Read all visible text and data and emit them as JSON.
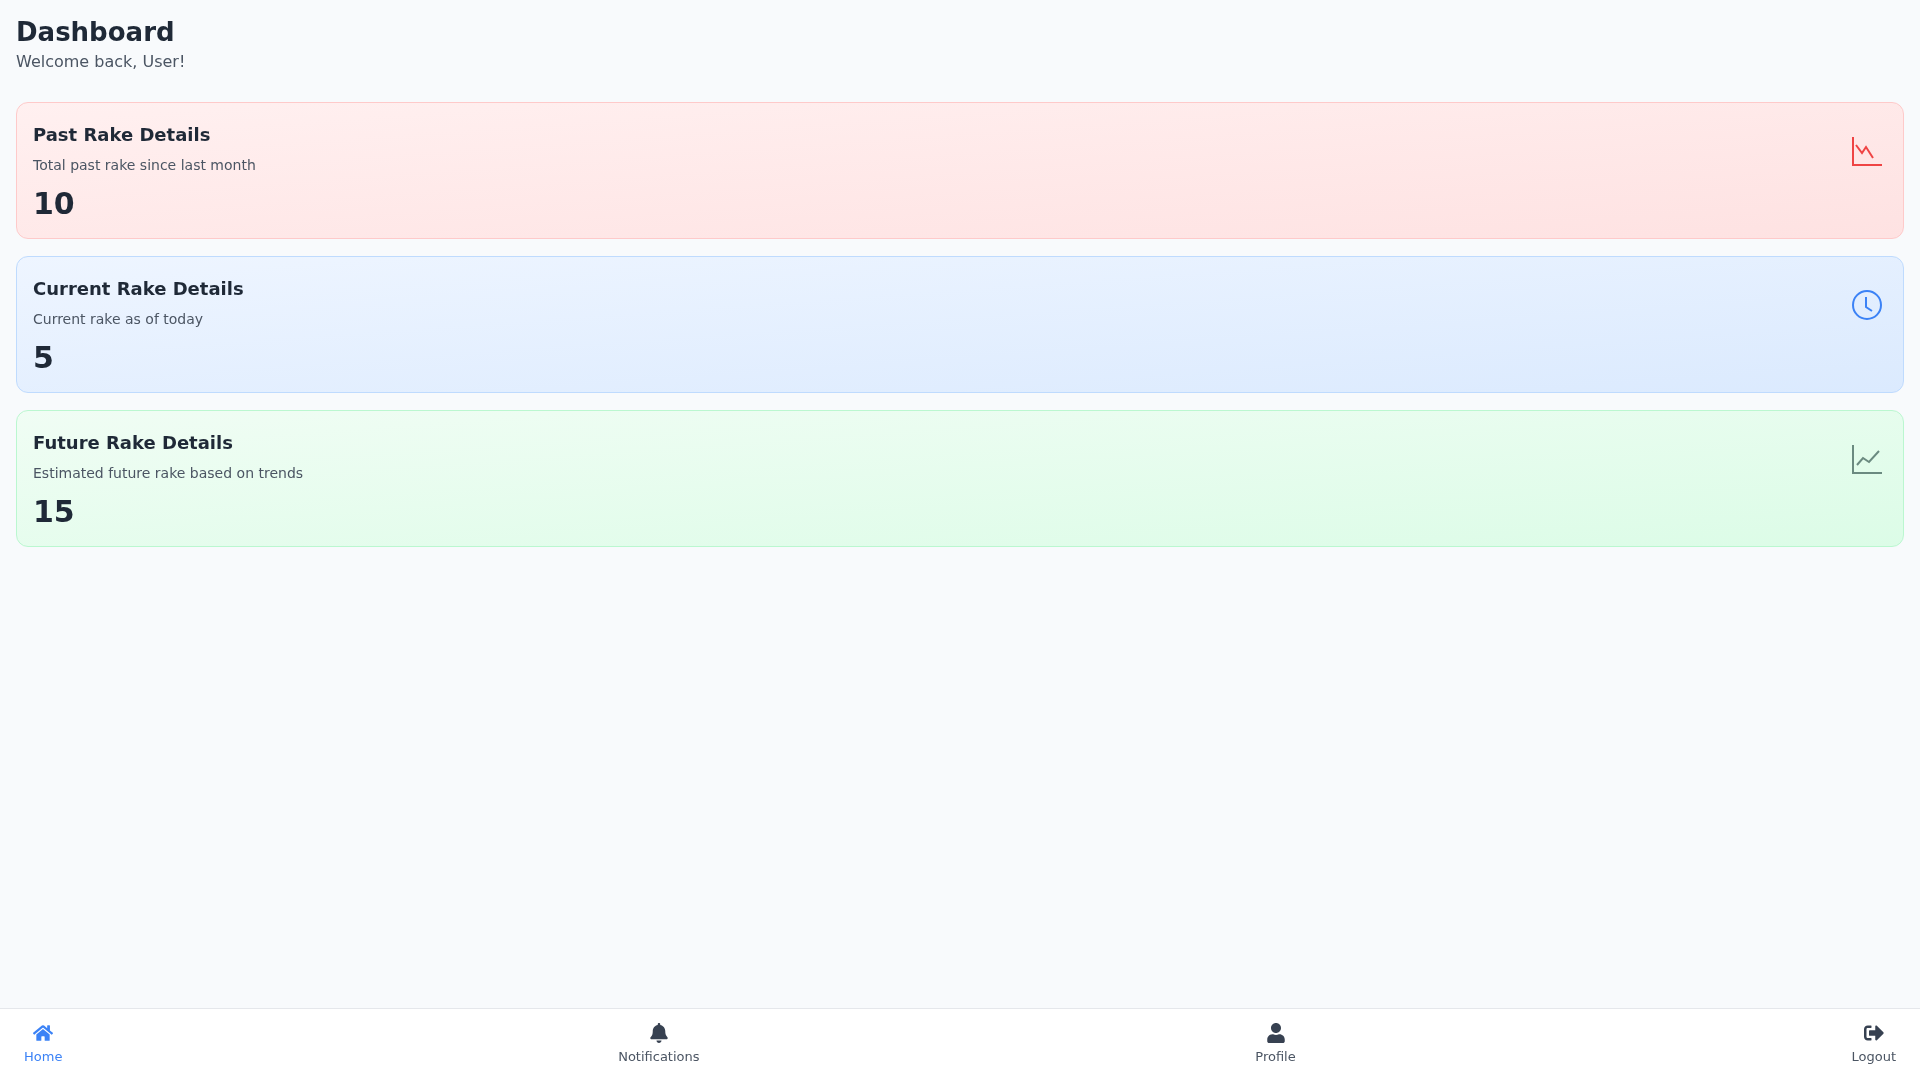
{
  "header": {
    "title": "Dashboard",
    "subtitle": "Welcome back, User!"
  },
  "cards": [
    {
      "kind": "past",
      "title": "Past Rake Details",
      "description": "Total past rake since last month",
      "value": "10"
    },
    {
      "kind": "current",
      "title": "Current Rake Details",
      "description": "Current rake as of today",
      "value": "5"
    },
    {
      "kind": "future",
      "title": "Future Rake Details",
      "description": "Estimated future rake based on trends",
      "value": "15"
    }
  ],
  "bottom_nav": [
    {
      "kind": "home",
      "label": "Home",
      "selected": true
    },
    {
      "kind": "notifications",
      "label": "Notifications",
      "selected": false
    },
    {
      "kind": "profile",
      "label": "Profile",
      "selected": false
    },
    {
      "kind": "logout",
      "label": "Logout",
      "selected": false
    }
  ]
}
